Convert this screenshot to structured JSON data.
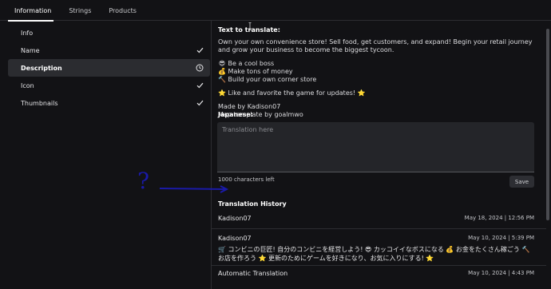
{
  "tabs": [
    {
      "label": "Information",
      "active": true
    },
    {
      "label": "Strings",
      "active": false
    },
    {
      "label": "Products",
      "active": false
    }
  ],
  "sidebar": {
    "items": [
      {
        "label": "Info",
        "status": "none"
      },
      {
        "label": "Name",
        "status": "check"
      },
      {
        "label": "Description",
        "status": "pending",
        "active": true
      },
      {
        "label": "Icon",
        "status": "check"
      },
      {
        "label": "Thumbnails",
        "status": "check"
      }
    ]
  },
  "main": {
    "source_heading": "Text to translate:",
    "source_lines": [
      "Own your own convenience store! Sell food, get customers, and expand! Begin your retail journey and grow your business to become the biggest tycoon.",
      "",
      "Be a cool boss",
      "Make tons of money",
      "Build your own corner store",
      "",
      "Like and favorite the game for updates!",
      "",
      "Made by Kadison07",
      "Map template by goalmwo"
    ],
    "emoji": {
      "cool": "😎",
      "money": "💰",
      "hammer": "🔨",
      "star": "⭐"
    },
    "target_label": "Japanese:",
    "textarea_placeholder": "Translation here",
    "textarea_value": "",
    "char_counter": "1000 characters left",
    "save_label": "Save"
  },
  "history": {
    "title": "Translation History",
    "entries": [
      {
        "user": "Kadison07",
        "date": "May 18, 2024 | 12:56 PM",
        "text": ""
      },
      {
        "user": "Kadison07",
        "date": "May 10, 2024 | 5:39 PM",
        "text": "🛒 コンビニの巨匠! 自分のコンビニを経営しよう! 😎 カッコイイなボスになる 💰 お金をたくさん稼ごう 🔨 お店を作ろう ⭐ 更新のためにゲームを好きになり、お気に入りにする! ⭐"
      },
      {
        "user": "Automatic Translation",
        "date": "May 10, 2024 | 4:43 PM",
        "text": ""
      }
    ]
  },
  "annotation": {
    "label": "?",
    "color": "#1a1aa8"
  },
  "colors": {
    "background": "#121215",
    "panel": "#242529",
    "divider": "#2c2d31",
    "active_item": "#2b2c30"
  }
}
